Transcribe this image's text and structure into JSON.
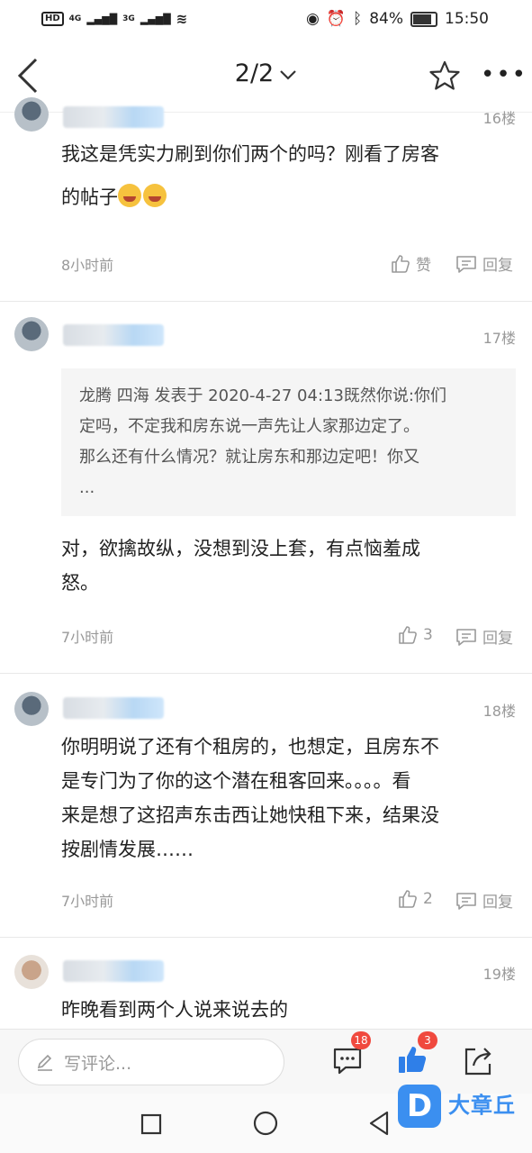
{
  "status": {
    "left_hd": "HD",
    "net1": "4G",
    "net2": "3G",
    "battery": "84%",
    "time": "15:50"
  },
  "header": {
    "pager": "2/2"
  },
  "comments": [
    {
      "floor": "16楼",
      "text1": "我这是凭实力刷到你们两个的吗？刚看了房客",
      "text2": "的帖子",
      "time": "8小时前",
      "like_label": "赞",
      "reply_label": "回复"
    },
    {
      "floor": "17楼",
      "quote": [
        "龙腾 四海 发表于 2020-4-27 04:13既然你说:你们",
        "定吗，不定我和房东说一声先让人家那边定了。",
        "那么还有什么情况？就让房东和那边定吧！你又",
        "..."
      ],
      "text": [
        "对，欲擒故纵，没想到没上套，有点恼羞成",
        "怒。"
      ],
      "time": "7小时前",
      "likes": "3",
      "reply_label": "回复"
    },
    {
      "floor": "18楼",
      "text": [
        "你明明说了还有个租房的，也想定，且房东不",
        "是专门为了你的这个潜在租客回来。。。。看",
        "来是想了这招声东击西让她快租下来，结果没",
        "按剧情发展……"
      ],
      "time": "7小时前",
      "likes": "2",
      "reply_label": "回复"
    },
    {
      "floor": "19楼",
      "text": "昨晚看到两个人说来说去的"
    }
  ],
  "bottom": {
    "placeholder": "写评论...",
    "comment_count": "18",
    "like_count": "3"
  },
  "watermark": {
    "logo": "D",
    "text": "大章丘"
  }
}
